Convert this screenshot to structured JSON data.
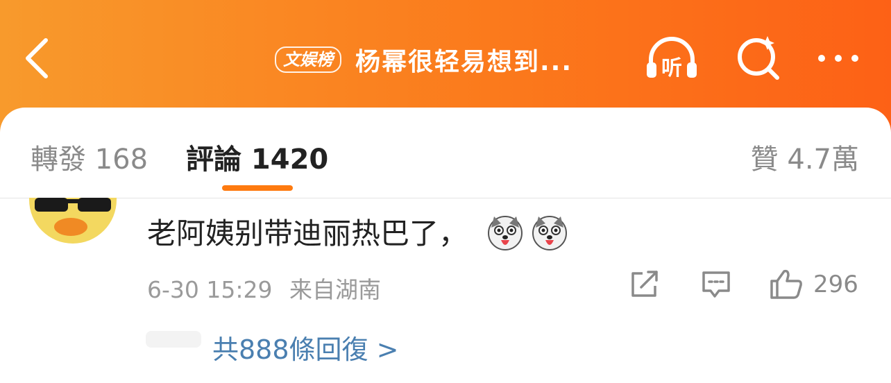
{
  "colors": {
    "accent": "#fe7a0f",
    "header_start": "#f89a2c",
    "header_end": "#fd6116",
    "link": "#4a7fb0"
  },
  "header": {
    "badge": "文娱榜",
    "title": "杨幂很轻易想到...",
    "listen_label": "听",
    "icons": [
      "back-icon",
      "listen-icon",
      "search-icon",
      "more-icon"
    ]
  },
  "tabs": {
    "repost": "轉發 168",
    "comments": "評論 1420",
    "likes": "贊 4.7萬"
  },
  "comment": {
    "text": "老阿姨别带迪丽热巴了，",
    "emojis": [
      "husky-emoji",
      "husky-emoji"
    ],
    "time": "6-30 15:29",
    "location": "来自湖南",
    "like_count": "296",
    "replies_link": "共888條回復 >"
  }
}
